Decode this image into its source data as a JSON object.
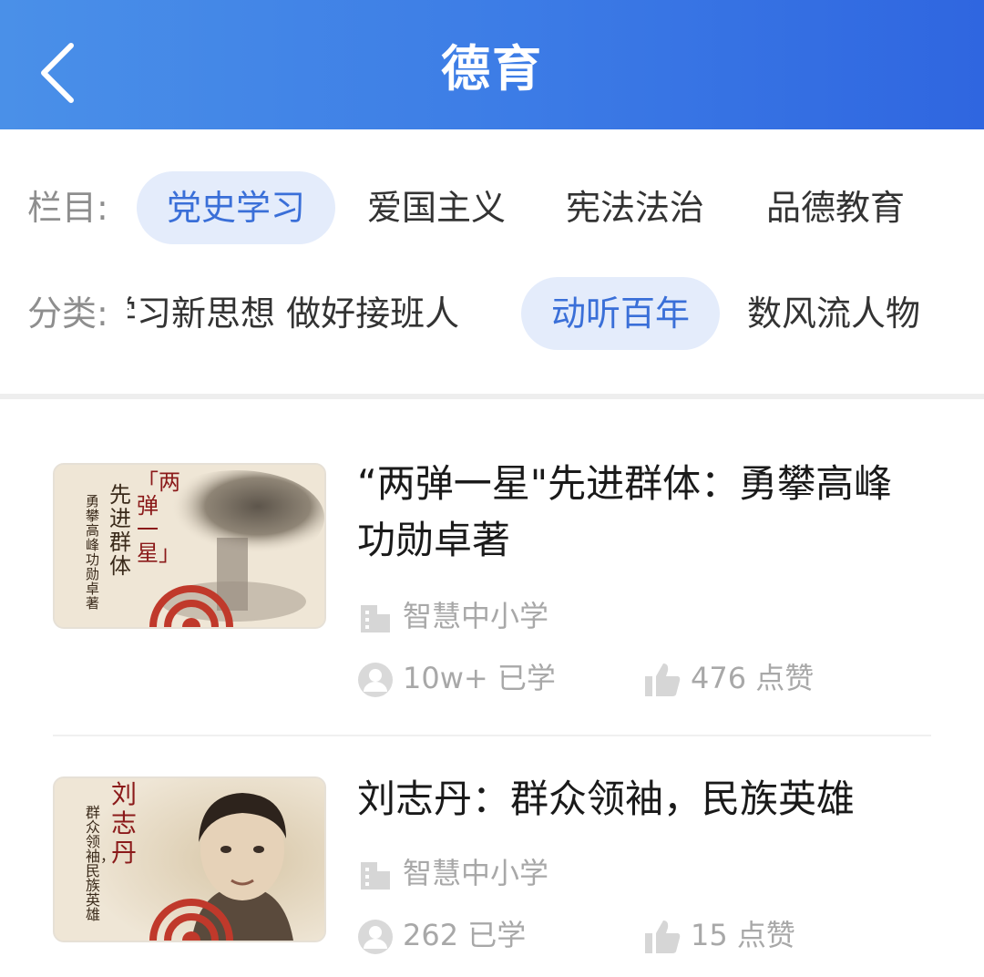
{
  "header": {
    "title": "德育",
    "back_icon": "chevron-left-icon"
  },
  "columns": {
    "label": "栏目:",
    "items": [
      {
        "label": "党史学习",
        "active": true
      },
      {
        "label": "爱国主义",
        "active": false
      },
      {
        "label": "宪法法治",
        "active": false
      },
      {
        "label": "品德教育",
        "active": false
      }
    ]
  },
  "categories": {
    "label": "分类:",
    "items": [
      {
        "label": "学习新思想 做好接班人",
        "active": false
      },
      {
        "label": "动听百年",
        "active": true
      },
      {
        "label": "数风流人物",
        "active": false
      }
    ]
  },
  "list": [
    {
      "title": "“两弹一星\"先进群体：勇攀高峰 功勋卓著",
      "source": "智慧中小学",
      "learners": "10w+ 已学",
      "likes": "476 点赞",
      "thumb": {
        "heading": "「两弹一星」",
        "subtitle": "先进群体",
        "motto": "勇攀高峰 功勋卓著"
      }
    },
    {
      "title": "刘志丹：群众领袖，民族英雄",
      "source": "智慧中小学",
      "learners": "262 已学",
      "likes": "15 点赞",
      "thumb": {
        "heading": "刘志丹",
        "motto": "群众领袖，民族英雄"
      }
    }
  ],
  "icons": {
    "source": "building-icon",
    "learners": "user-icon",
    "likes": "thumbs-up-icon"
  },
  "colors": {
    "header_start": "#4a90e8",
    "header_end": "#2f66e0",
    "chip_active_bg": "#e4ecfb",
    "chip_active_text": "#3a6fd8"
  }
}
